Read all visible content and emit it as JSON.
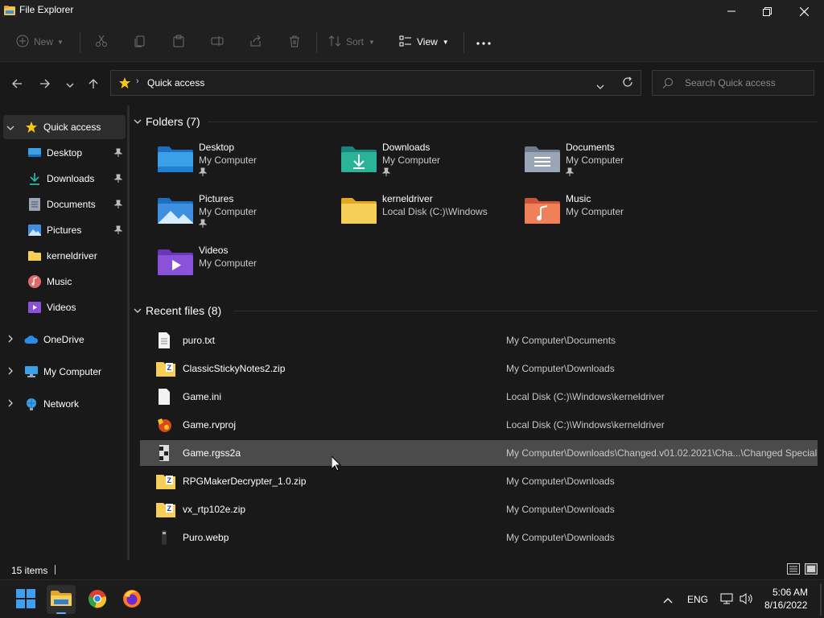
{
  "window": {
    "title": "File Explorer"
  },
  "toolbar": {
    "new_label": "New",
    "sort_label": "Sort",
    "view_label": "View"
  },
  "address": {
    "current": "Quick access",
    "search_placeholder": "Search Quick access"
  },
  "sidebar": {
    "quick_access": "Quick access",
    "pinned": [
      {
        "label": "Desktop",
        "icon": "desktop-icon"
      },
      {
        "label": "Downloads",
        "icon": "downloads-icon"
      },
      {
        "label": "Documents",
        "icon": "documents-icon"
      },
      {
        "label": "Pictures",
        "icon": "pictures-icon"
      }
    ],
    "others": [
      {
        "label": "kerneldriver",
        "icon": "folder-icon"
      },
      {
        "label": "Music",
        "icon": "music-icon"
      },
      {
        "label": "Videos",
        "icon": "videos-icon"
      }
    ],
    "roots": [
      {
        "label": "OneDrive",
        "icon": "cloud-icon"
      },
      {
        "label": "My Computer",
        "icon": "computer-icon"
      },
      {
        "label": "Network",
        "icon": "network-icon"
      }
    ]
  },
  "folders": {
    "title": "Folders (7)",
    "items": [
      {
        "name": "Desktop",
        "location": "My Computer",
        "pinned": true,
        "color": "#3aa0e8"
      },
      {
        "name": "Downloads",
        "location": "My Computer",
        "pinned": true,
        "color": "#2bb39a"
      },
      {
        "name": "Documents",
        "location": "My Computer",
        "pinned": true,
        "color": "#9aa6b5"
      },
      {
        "name": "Pictures",
        "location": "My Computer",
        "pinned": true,
        "color": "#3f8fe0"
      },
      {
        "name": "kerneldriver",
        "location": "Local Disk (C:)\\Windows",
        "pinned": false,
        "color": "#f5cf57"
      },
      {
        "name": "Music",
        "location": "My Computer",
        "pinned": false,
        "color": "#f0805a"
      },
      {
        "name": "Videos",
        "location": "My Computer",
        "pinned": false,
        "color": "#8a52d9"
      }
    ]
  },
  "recent": {
    "title": "Recent files (8)",
    "items": [
      {
        "name": "puro.txt",
        "path": "My Computer\\Documents",
        "icon": "text-file-icon"
      },
      {
        "name": "ClassicStickyNotes2.zip",
        "path": "My Computer\\Downloads",
        "icon": "zip-icon"
      },
      {
        "name": "Game.ini",
        "path": "Local Disk (C:)\\Windows\\kerneldriver",
        "icon": "blank-file-icon"
      },
      {
        "name": "Game.rvproj",
        "path": "Local Disk (C:)\\Windows\\kerneldriver",
        "icon": "rpg-maker-icon"
      },
      {
        "name": "Game.rgss2a",
        "path": "My Computer\\Downloads\\Changed.v01.02.2021\\Cha...\\Changed Special",
        "icon": "rgss-file-icon"
      },
      {
        "name": "RPGMakerDecrypter_1.0.zip",
        "path": "My Computer\\Downloads",
        "icon": "zip-icon"
      },
      {
        "name": "vx_rtp102e.zip",
        "path": "My Computer\\Downloads",
        "icon": "zip-icon"
      },
      {
        "name": "Puro.webp",
        "path": "My Computer\\Downloads",
        "icon": "image-file-icon"
      }
    ]
  },
  "status": {
    "count": "15 items"
  },
  "taskbar": {
    "language": "ENG",
    "time": "5:06 AM",
    "date": "8/16/2022"
  }
}
